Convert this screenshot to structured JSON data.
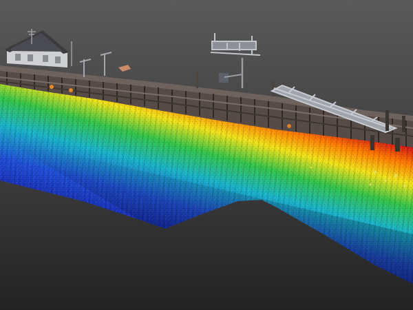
{
  "scene": {
    "subject": "multibeam-sonar-point-cloud-of-pier-and-seabed",
    "background_top": "#565656",
    "background_bottom": "#262626",
    "depth_colormap": [
      "#d21818",
      "#ff7a00",
      "#f2e21a",
      "#34c44a",
      "#1ab3c8",
      "#1f4fd6",
      "#14189a"
    ],
    "colormap_name": "jet",
    "structures": [
      "shed",
      "timber-pier",
      "sign-gantry",
      "lamp-post",
      "gangway-ramp",
      "mooring-posts",
      "piling"
    ],
    "colors": {
      "wood": "#5a4f4a",
      "wood_dark": "#3e3633",
      "metal": "#b9bcc2",
      "roof": "#3b3b40",
      "wall": "#d0d0d4"
    }
  }
}
